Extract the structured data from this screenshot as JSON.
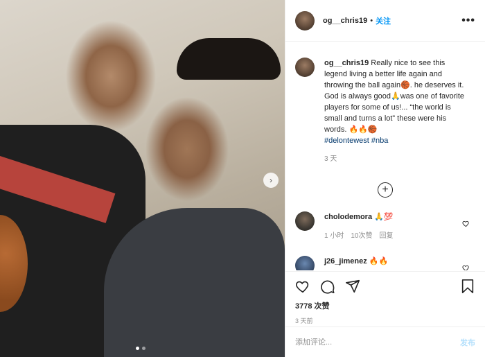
{
  "post": {
    "username": "og__chris19",
    "follow_sep": "•",
    "follow_label": "关注",
    "more_glyph": "•••",
    "next_glyph": "›",
    "carousel": {
      "count": 2,
      "active": 1
    },
    "caption": {
      "username": "og__chris19",
      "text": "Really nice to see this legend living a better life again and throwing the ball again🏀. he deserves it. God is always good🙏was one of favorite players for some of us!... “the world is small and turns a lot” these were his words. 🔥🔥🏀",
      "tags": "#delontewest #nba",
      "time": "3 天"
    },
    "load_more_glyph": "+",
    "comments": [
      {
        "username": "cholodemora",
        "text": "🙏💯",
        "time": "1 小时",
        "likes": "10次赞",
        "reply": "回复"
      },
      {
        "username": "j26_jimenez",
        "text": "🔥🔥"
      }
    ],
    "likes": "3778 次赞",
    "posted": "3 天前",
    "add_comment_placeholder": "添加评论...",
    "post_label": "发布"
  }
}
